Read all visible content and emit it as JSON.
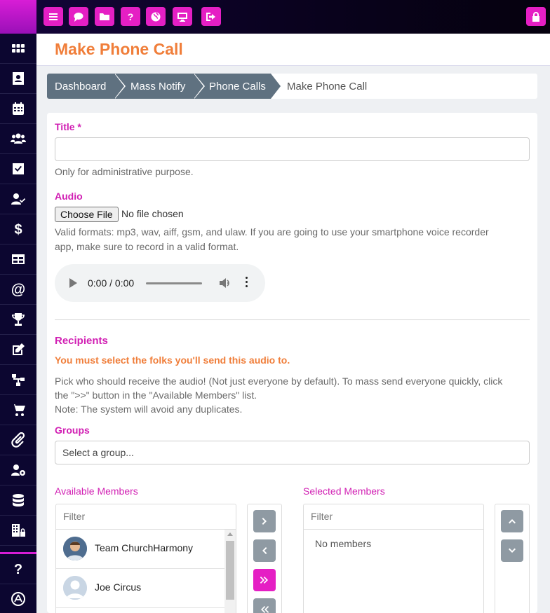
{
  "topbar": {
    "buttons": [
      {
        "icon": "bars-icon",
        "label": "Menu"
      },
      {
        "icon": "chat-icon",
        "label": "Messages"
      },
      {
        "icon": "folder-icon",
        "label": "Files"
      },
      {
        "icon": "help-icon",
        "label": "Help"
      },
      {
        "icon": "globe-icon",
        "label": "Website"
      },
      {
        "icon": "monitor-icon",
        "label": "Display"
      },
      {
        "icon": "sign-out-icon",
        "label": "Sign out"
      }
    ],
    "lock_icon": "lock-icon"
  },
  "sidebar": {
    "items": [
      "grid-icon",
      "contacts-icon",
      "calendar-icon",
      "users-icon",
      "checkbox-icon",
      "user-check-icon",
      "dollar-icon",
      "table-icon",
      "at-icon",
      "trophy-icon",
      "edit-icon",
      "sitemap-icon",
      "cart-icon",
      "paperclip-icon",
      "user-gear-icon",
      "database-icon",
      "building-icon",
      "question-icon",
      "app-store-icon"
    ]
  },
  "page": {
    "title": "Make Phone Call"
  },
  "breadcrumb": [
    "Dashboard",
    "Mass Notify",
    "Phone Calls",
    "Make Phone Call"
  ],
  "form": {
    "title_label": "Title",
    "required_mark": "*",
    "title_value": "",
    "title_help": "Only for administrative purpose.",
    "audio_label": "Audio",
    "file_button": "Choose File",
    "file_status": "No file chosen",
    "audio_help_1": "Valid formats: mp3, wav, aiff, gsm, and ulaw. If you are going to use your smartphone voice recorder",
    "audio_help_2": "app, make sure to record in a valid format.",
    "player_time": "0:00 / 0:00",
    "recipients_title": "Recipients",
    "recipients_warning": "You must select the folks you'll send this audio to.",
    "recipients_help_1": "Pick who should receive the audio! (Not just everyone by default). To mass send everyone quickly, click",
    "recipients_help_2": "the \">>\" button in the \"Available Members\" list.",
    "recipients_note": "Note: The system will avoid any duplicates.",
    "groups_label": "Groups",
    "groups_placeholder": "Select a group..."
  },
  "available": {
    "label": "Available Members",
    "filter_placeholder": "Filter",
    "members": [
      {
        "name": "Team ChurchHarmony",
        "avatar": "photo"
      },
      {
        "name": "Joe Circus",
        "avatar": "default"
      }
    ]
  },
  "selected": {
    "label": "Selected Members",
    "filter_placeholder": "Filter",
    "empty_text": "No members"
  },
  "colors": {
    "accent": "#e51fc4",
    "title": "#f07e3a",
    "label": "#d11fb3",
    "breadcrumb": "#5f7180"
  }
}
